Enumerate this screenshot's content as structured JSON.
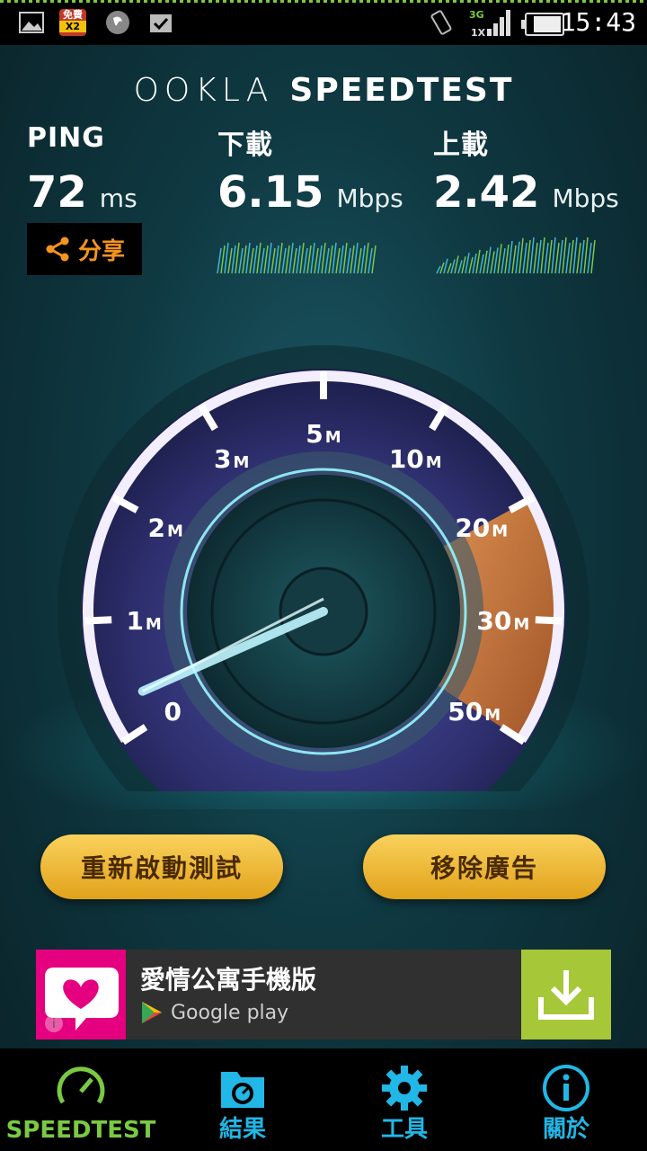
{
  "status_bar": {
    "time": "15:43",
    "network": "3G",
    "network_secondary": "1X",
    "notification_badge_top": "免費",
    "notification_badge_bottom": "X2"
  },
  "header": {
    "brand_logo": "OOKLA",
    "brand_product": "SPEEDTEST"
  },
  "metrics": {
    "ping": {
      "label": "PING",
      "value": "72",
      "unit": "ms"
    },
    "download": {
      "label": "下載",
      "value": "6.15",
      "unit": "Mbps"
    },
    "upload": {
      "label": "上載",
      "value": "2.42",
      "unit": "Mbps"
    }
  },
  "share_button": {
    "label": "分享",
    "icon": "share-icon"
  },
  "gauge": {
    "ticks": [
      {
        "main": "0",
        "suffix": ""
      },
      {
        "main": "1",
        "suffix": "M"
      },
      {
        "main": "2",
        "suffix": "M"
      },
      {
        "main": "3",
        "suffix": "M"
      },
      {
        "main": "5",
        "suffix": "M"
      },
      {
        "main": "10",
        "suffix": "M"
      },
      {
        "main": "20",
        "suffix": "M"
      },
      {
        "main": "30",
        "suffix": "M"
      },
      {
        "main": "50",
        "suffix": "M"
      }
    ],
    "needle_value_index": 0.3,
    "colors": {
      "ring": "#f3eefe",
      "accent": "#f28c2a",
      "needle": "#bff6ff"
    }
  },
  "actions": {
    "restart_label": "重新啟動測試",
    "remove_ads_label": "移除廣告"
  },
  "ad": {
    "title": "愛情公寓手機版",
    "store": "Google play"
  },
  "bottom_nav": {
    "items": [
      {
        "label": "SPEEDTEST",
        "icon": "speedometer-icon",
        "active": true
      },
      {
        "label": "結果",
        "icon": "folder-results-icon",
        "active": false
      },
      {
        "label": "工具",
        "icon": "gear-icon",
        "active": false
      },
      {
        "label": "關於",
        "icon": "info-icon",
        "active": false
      }
    ],
    "active_color": "#7ac943",
    "inactive_color": "#21b7e6"
  }
}
